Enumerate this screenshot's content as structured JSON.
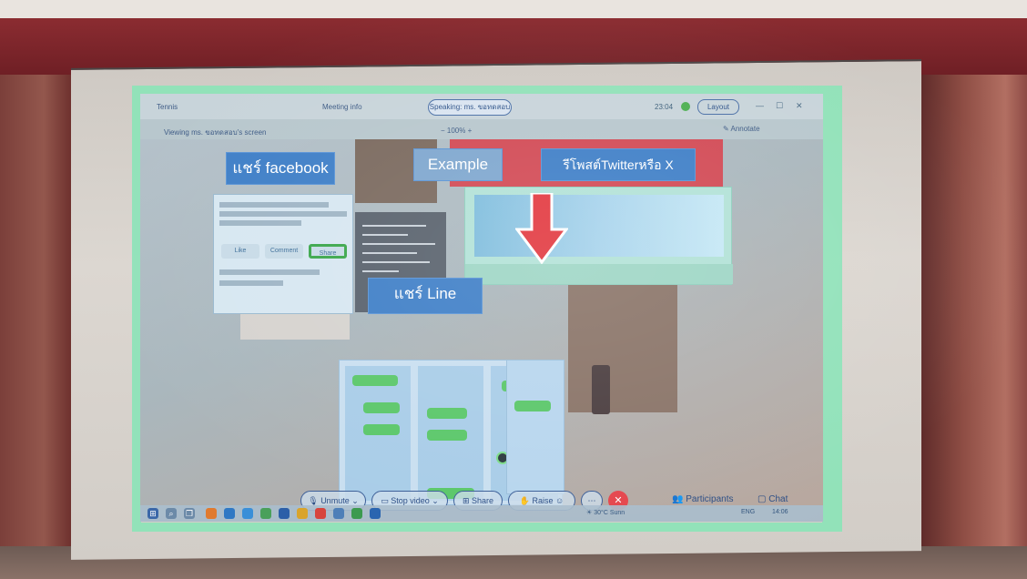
{
  "window": {
    "title": "Tennis",
    "meeting_info": "Meeting info",
    "speaking": "Speaking: ms. ขอทดสอบ",
    "time": "23:04",
    "layout_label": "Layout",
    "controls": [
      "—",
      "☐",
      "✕"
    ]
  },
  "view_bar": {
    "viewing": "Viewing ms. ขอทดสอบ's screen",
    "zoom": "−   100%   +",
    "annotate": "✎ Annotate"
  },
  "shared_slide": {
    "labels": {
      "facebook": "แชร์ facebook",
      "example": "Example",
      "twitter": "รีโพสต์Twitterหรือ X",
      "line": "แชร์ Line"
    },
    "facebook_buttons": [
      "Like",
      "Comment",
      "Share"
    ]
  },
  "toolbar": {
    "unmute": "Unmute",
    "stop_video": "Stop video",
    "share": "Share",
    "raise": "Raise",
    "participants": "Participants",
    "chat": "Chat"
  },
  "taskbar": {
    "weather": "30°C Sunn",
    "lang": "ENG",
    "clock": "14:06"
  },
  "colors": {
    "screen_outline": "#8ee3b8",
    "label_blue": "#3f7fc7",
    "arrow_red": "#e2383f",
    "end_button": "#e5474e"
  }
}
